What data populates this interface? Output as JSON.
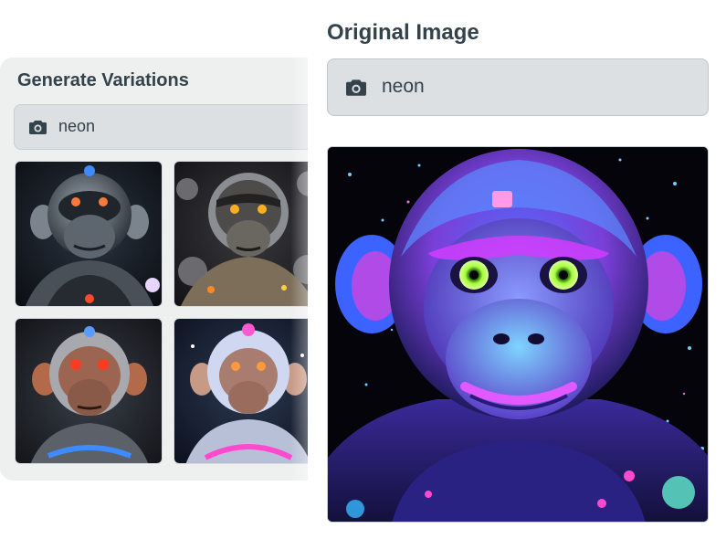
{
  "variations": {
    "title": "Generate Variations",
    "search_value": "neon",
    "search_icon": "camera-icon",
    "thumbnails": [
      {
        "style": "chrome",
        "icon": "robot-monkey-chrome"
      },
      {
        "style": "steampunk",
        "icon": "robot-monkey-steampunk"
      },
      {
        "style": "red-eyes",
        "icon": "robot-monkey-red-eyes"
      },
      {
        "style": "crystal",
        "icon": "robot-monkey-crystal"
      }
    ]
  },
  "original": {
    "title": "Original Image",
    "search_value": "neon",
    "search_icon": "camera-icon",
    "image_subject": "neon-monkey"
  },
  "colors": {
    "text": "#34424b",
    "panel_bg": "#eef0ef",
    "input_bg": "#dde0e3",
    "neon_blue": "#38b6ff",
    "neon_purple": "#c13cff",
    "neon_green": "#a8ff3a"
  }
}
